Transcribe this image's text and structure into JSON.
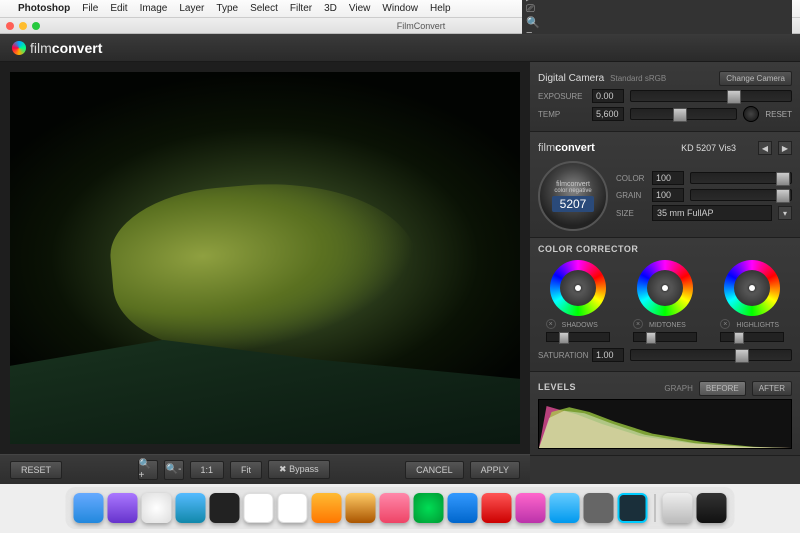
{
  "menubar": {
    "app": "Photoshop",
    "items": [
      "File",
      "Edit",
      "Image",
      "Layer",
      "Type",
      "Select",
      "Filter",
      "3D",
      "View",
      "Window",
      "Help"
    ]
  },
  "window": {
    "title": "FilmConvert"
  },
  "logo": {
    "prefix": "film",
    "suffix": "convert"
  },
  "camera": {
    "title": "Digital Camera",
    "profile": "Standard sRGB",
    "change": "Change Camera",
    "exposure_label": "EXPOSURE",
    "exposure": "0.00",
    "temp_label": "TEMP",
    "temp": "5,600",
    "reset": "RESET"
  },
  "film": {
    "logo_prefix": "film",
    "logo_suffix": "convert",
    "stock": "KD 5207 Vis3",
    "dial_brand": "filmconvert",
    "dial_sub": "color negative",
    "dial_num": "5207",
    "color_label": "COLOR",
    "color": "100",
    "grain_label": "GRAIN",
    "grain": "100",
    "size_label": "SIZE",
    "size": "35 mm FullAP"
  },
  "color_corrector": {
    "title": "COLOR CORRECTOR",
    "shadows": "SHADOWS",
    "midtones": "MIDTONES",
    "highlights": "HIGHLIGHTS",
    "sat_label": "SATURATION",
    "sat": "1.00"
  },
  "levels": {
    "title": "LEVELS",
    "graph": "GRAPH",
    "before": "BEFORE",
    "after": "AFTER"
  },
  "toolbar": {
    "reset": "RESET",
    "one_to_one": "1:1",
    "fit": "Fit",
    "bypass": "Bypass",
    "cancel": "CANCEL",
    "apply": "APPLY"
  }
}
